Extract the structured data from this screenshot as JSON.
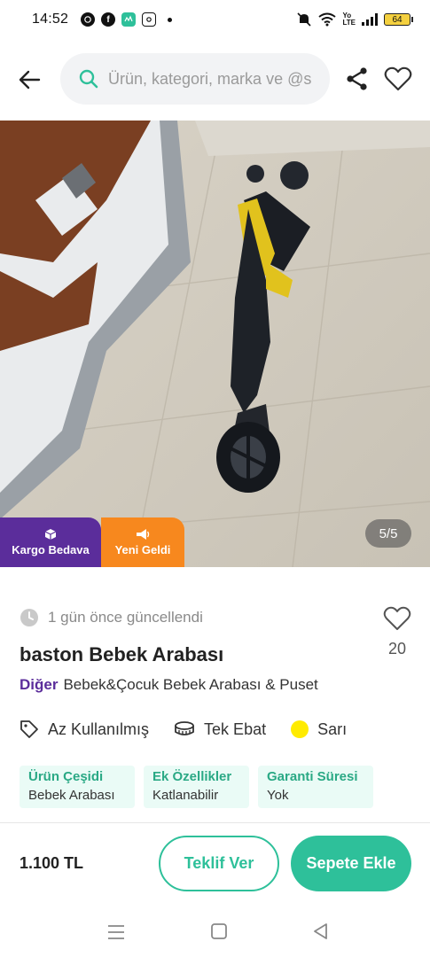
{
  "status": {
    "time": "14:52",
    "battery": "64"
  },
  "search": {
    "placeholder": "Ürün, kategori, marka ve @satıcı ara"
  },
  "gallery": {
    "counter": "5/5",
    "badges": {
      "kargo": "Kargo Bedava",
      "yeni": "Yeni Geldi"
    }
  },
  "listing": {
    "updated": "1 gün önce güncellendi",
    "title": "baston Bebek Arabası",
    "brand": "Diğer",
    "category": "Bebek&Çocuk Bebek Arabası & Puset",
    "favorites": "20",
    "condition": "Az Kullanılmış",
    "size": "Tek Ebat",
    "color_name": "Sarı",
    "color_hex": "#ffeb00",
    "attributes": [
      {
        "key": "Ürün Çeşidi",
        "value": "Bebek Arabası"
      },
      {
        "key": "Ek Özellikler",
        "value": "Katlanabilir"
      },
      {
        "key": "Garanti Süresi",
        "value": "Yok"
      }
    ]
  },
  "bottom": {
    "price": "1.100 TL",
    "offer_label": "Teklif Ver",
    "cart_label": "Sepete Ekle"
  },
  "colors": {
    "accent": "#2ec09a",
    "brand_purple": "#5b2d9b",
    "orange": "#f7881e"
  }
}
